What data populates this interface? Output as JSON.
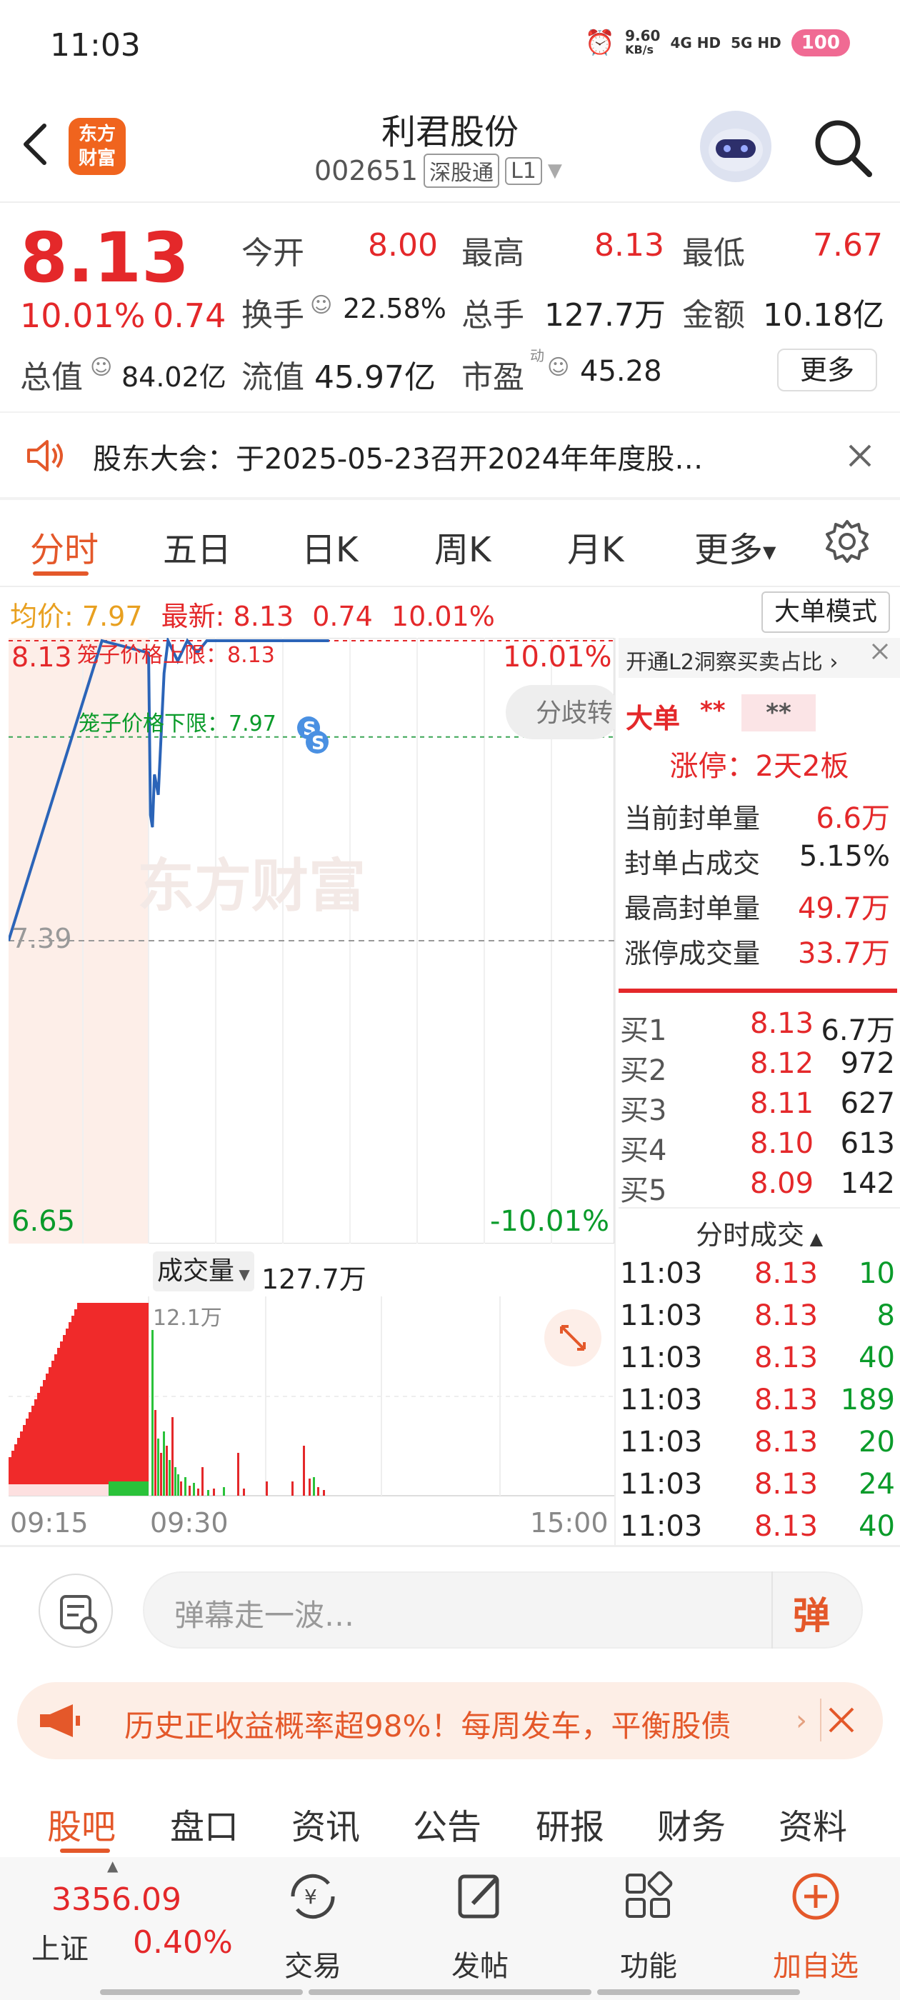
{
  "status_bar": {
    "time": "11:03",
    "net_speed": "9.60",
    "net_unit": "KB/s",
    "sig1": "4G HD",
    "sig2": "5G HD",
    "battery": "100"
  },
  "header": {
    "logo_text": "东方财富",
    "title": "利君股份",
    "code": "002651",
    "tag1": "深股通",
    "tag2": "L1"
  },
  "quote": {
    "price": "8.13",
    "change_pct": "10.01%",
    "change": "0.74",
    "open_label": "今开",
    "open": "8.00",
    "high_label": "最高",
    "high": "8.13",
    "low_label": "最低",
    "low": "7.67",
    "turnover_label": "换手",
    "turnover": "22.58%",
    "volume_label": "总手",
    "volume": "127.7万",
    "amount_label": "金额",
    "amount": "10.18亿",
    "mktcap_label": "总值",
    "mktcap": "84.02亿",
    "float_label": "流值",
    "float": "45.97亿",
    "pe_label": "市盈",
    "pe_sup": "动",
    "pe": "45.28",
    "more": "更多"
  },
  "notice": {
    "text": "股东大会：于2025-05-23召开2024年年度股…"
  },
  "chart_tabs": [
    "分时",
    "五日",
    "日K",
    "周K",
    "月K",
    "更多"
  ],
  "info_line": {
    "avg_label": "均价:",
    "avg": "7.97",
    "latest_label": "最新:",
    "latest": "8.13",
    "chg": "0.74",
    "chg_pct": "10.01%",
    "mode_btn": "大单模式"
  },
  "chart": {
    "upper_price": "8.13",
    "upper_pct": "10.01%",
    "mid_price": "7.39",
    "lower_price": "6.65",
    "lower_pct": "-10.01%",
    "cage_upper": "笼子价格上限：8.13",
    "cage_lower": "笼子价格下限：7.97",
    "divergence_btn": "分歧转",
    "watermark": "东方财富",
    "badge_s": "S"
  },
  "volume": {
    "label": "成交量",
    "total": "127.7万",
    "peak": "12.1万",
    "time_start": "09:15",
    "time_open": "09:30",
    "time_end": "15:00"
  },
  "chart_data": {
    "type": "line",
    "title": "",
    "xlabel": "",
    "ylabel": "",
    "x_ticks": [
      "09:15",
      "09:30",
      "15:00"
    ],
    "y_ticks": [
      "8.13",
      "7.39",
      "6.65"
    ],
    "ylim": [
      6.65,
      8.13
    ],
    "series": [
      {
        "x": [
          "09:15",
          "09:25",
          "09:30",
          "09:31",
          "09:32",
          "09:33",
          "09:35",
          "09:38",
          "09:40",
          "09:45",
          "09:50",
          "09:55",
          "10:00",
          "10:10",
          "10:20",
          "10:30",
          "10:45",
          "11:00",
          "11:03"
        ],
        "values": [
          7.39,
          8.13,
          8.1,
          7.7,
          7.67,
          7.8,
          7.75,
          8.05,
          8.13,
          8.08,
          8.13,
          8.1,
          8.13,
          8.13,
          8.13,
          8.13,
          8.13,
          8.13,
          8.13
        ]
      }
    ],
    "reference_lines": [
      {
        "value": 8.13,
        "label": "笼子价格上限：8.13"
      },
      {
        "value": 7.97,
        "label": "笼子价格下限：7.97"
      }
    ]
  },
  "right_panel": {
    "l2_title": "开通L2洞察买卖占比",
    "big_order": "大单",
    "big_order_val1": "**",
    "big_order_val2": "**",
    "limit_up": "涨停：2天2板",
    "rows": [
      {
        "label": "当前封单量",
        "value": "6.6万"
      },
      {
        "label": "封单占成交",
        "value": "5.15%"
      },
      {
        "label": "最高封单量",
        "value": "49.7万"
      },
      {
        "label": "涨停成交量",
        "value": "33.7万"
      }
    ],
    "order_book": [
      {
        "label": "买1",
        "price": "8.13",
        "vol": "6.7万"
      },
      {
        "label": "买2",
        "price": "8.12",
        "vol": "972"
      },
      {
        "label": "买3",
        "price": "8.11",
        "vol": "627"
      },
      {
        "label": "买4",
        "price": "8.10",
        "vol": "613"
      },
      {
        "label": "买5",
        "price": "8.09",
        "vol": "142"
      }
    ],
    "ticks_title": "分时成交",
    "ticks": [
      {
        "time": "11:03",
        "price": "8.13",
        "vol": "10"
      },
      {
        "time": "11:03",
        "price": "8.13",
        "vol": "8"
      },
      {
        "time": "11:03",
        "price": "8.13",
        "vol": "40"
      },
      {
        "time": "11:03",
        "price": "8.13",
        "vol": "189"
      },
      {
        "time": "11:03",
        "price": "8.13",
        "vol": "20"
      },
      {
        "time": "11:03",
        "price": "8.13",
        "vol": "24"
      },
      {
        "time": "11:03",
        "price": "8.13",
        "vol": "40"
      }
    ]
  },
  "danmu": {
    "placeholder": "弹幕走一波…",
    "btn": "弹"
  },
  "banner": {
    "text": "历史正收益概率超98%！每周发车，平衡股债"
  },
  "bottom_tabs": [
    "股吧",
    "盘口",
    "资讯",
    "公告",
    "研报",
    "财务",
    "资料"
  ],
  "bottom_nav": {
    "index_value": "3356.09",
    "index_name": "上证",
    "index_pct": "0.40%",
    "items": [
      "交易",
      "发帖",
      "功能",
      "加自选"
    ]
  },
  "colors": {
    "up": "#e4282a",
    "down": "#0a9b2a",
    "accent": "#e4582a",
    "line": "#2b64b8"
  }
}
